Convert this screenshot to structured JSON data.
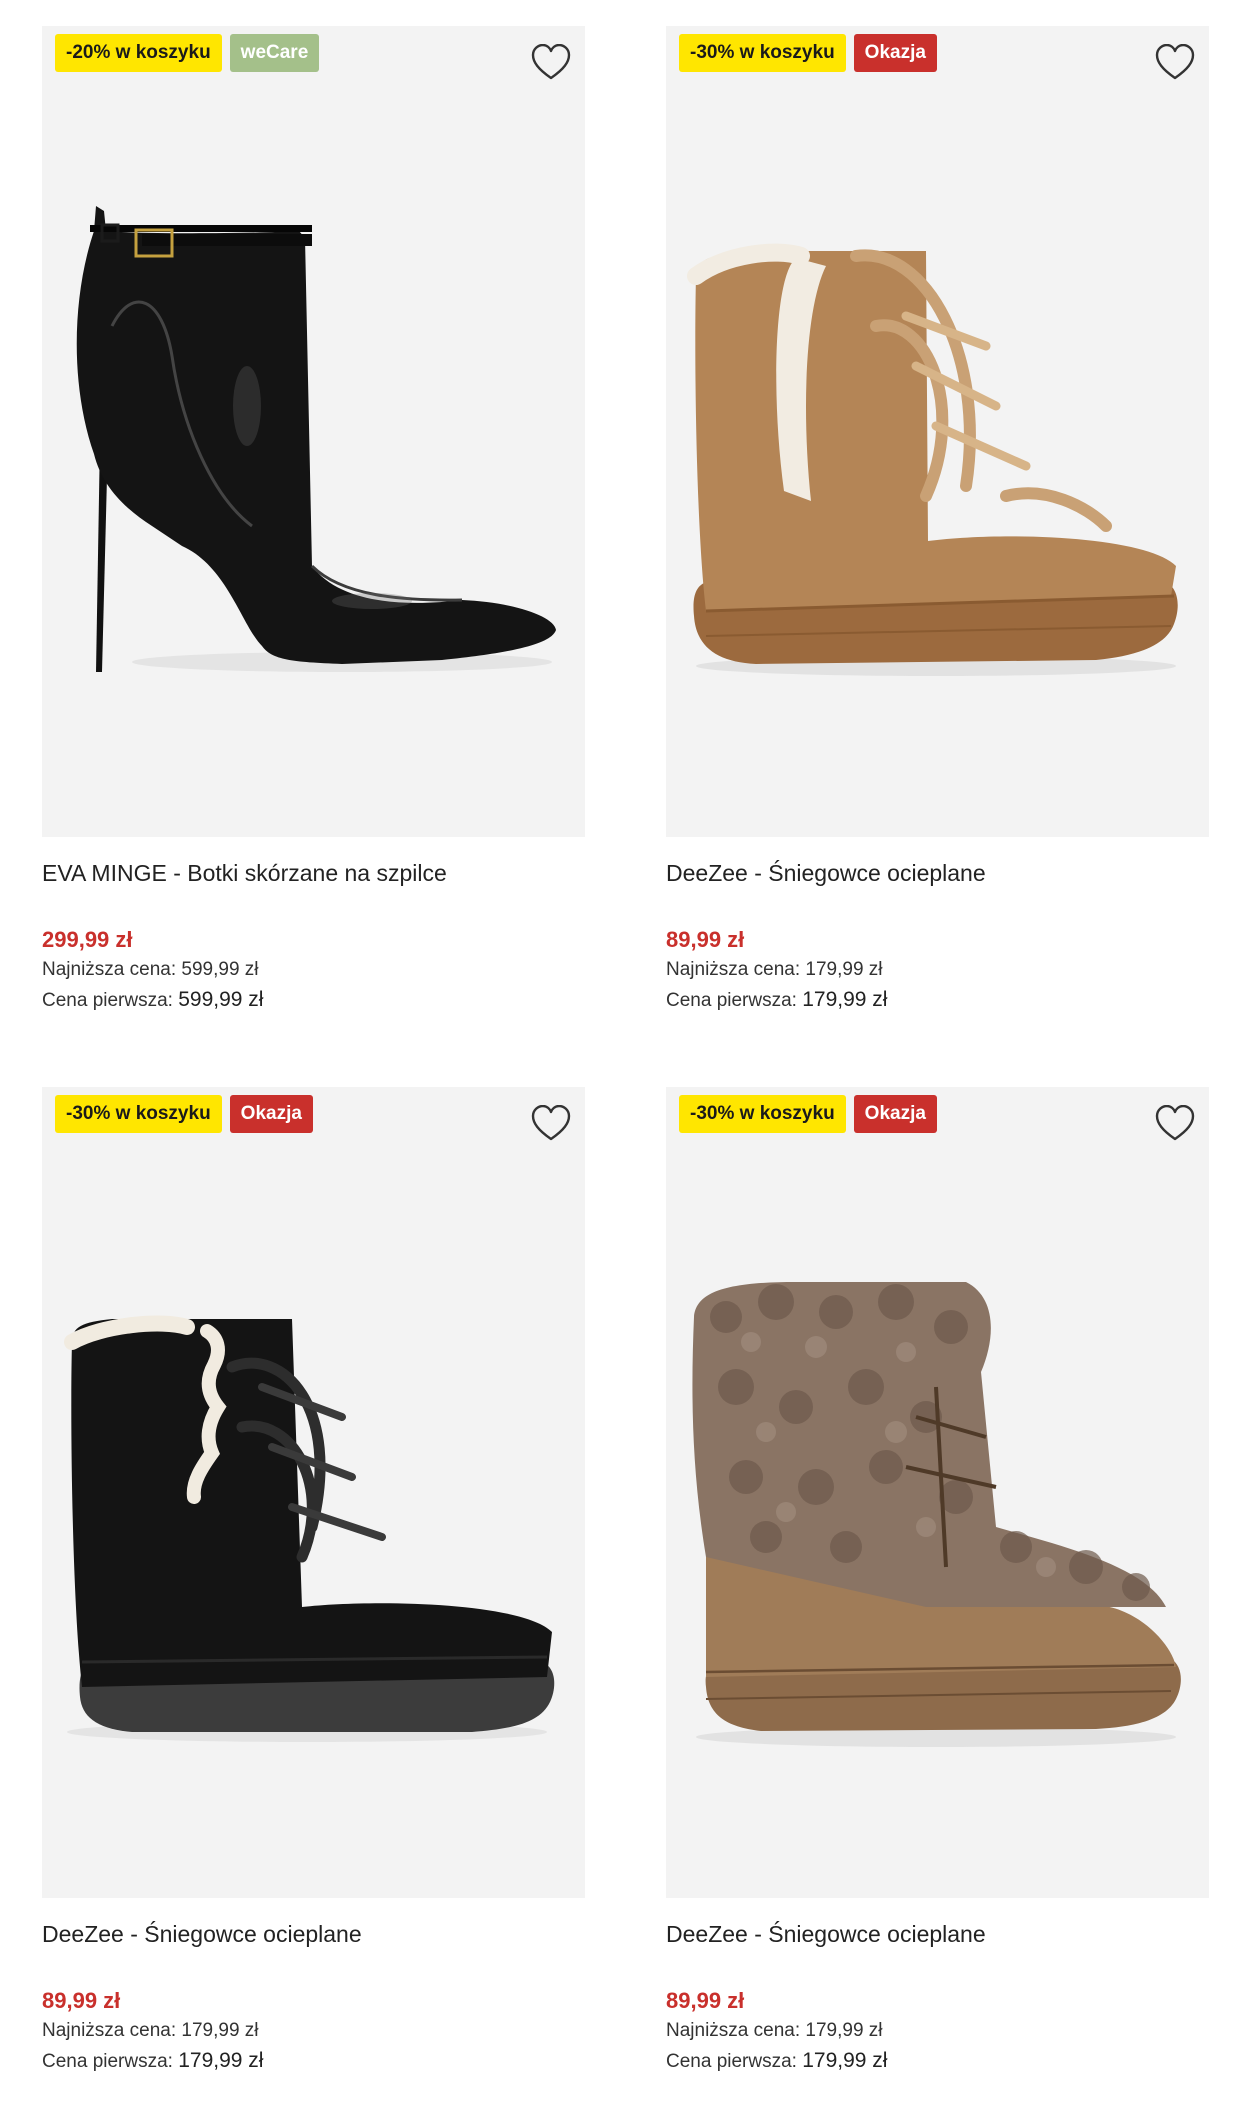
{
  "products": [
    {
      "promo_badge": "-20% w koszyku",
      "secondary_badge": "weCare",
      "title": "EVA MINGE - Botki skórzane na szpilce",
      "price": "299,99 zł",
      "lowest_label": "Najniższa cena:",
      "lowest_value": "599,99 zł",
      "first_label": "Cena pierwsza:",
      "first_value": "599,99 zł",
      "image": "black-patent-stiletto-ankle-boot"
    },
    {
      "promo_badge": "-30% w koszyku",
      "secondary_badge": "Okazja",
      "title": "DeeZee - Śniegowce ocieplane",
      "price": "89,99 zł",
      "lowest_label": "Najniższa cena:",
      "lowest_value": "179,99 zł",
      "first_label": "Cena pierwsza:",
      "first_value": "179,99 zł",
      "image": "camel-suede-snow-boot"
    },
    {
      "promo_badge": "-30% w koszyku",
      "secondary_badge": "Okazja",
      "title": "DeeZee - Śniegowce ocieplane",
      "price": "89,99 zł",
      "lowest_label": "Najniższa cena:",
      "lowest_value": "179,99 zł",
      "first_label": "Cena pierwsza:",
      "first_value": "179,99 zł",
      "image": "black-suede-snow-boot"
    },
    {
      "promo_badge": "-30% w koszyku",
      "secondary_badge": "Okazja",
      "title": "DeeZee - Śniegowce ocieplane",
      "price": "89,99 zł",
      "lowest_label": "Najniższa cena:",
      "lowest_value": "179,99 zł",
      "first_label": "Cena pierwsza:",
      "first_value": "179,99 zł",
      "image": "brown-fur-snow-boot"
    }
  ],
  "icons": {
    "wishlist": "heart-outline-icon"
  },
  "colors": {
    "promo_badge": "#ffe600",
    "wecare_badge": "#a4c08a",
    "okazja_badge": "#c9302c",
    "sale_price": "#c9302c",
    "image_bg": "#f3f3f3"
  }
}
